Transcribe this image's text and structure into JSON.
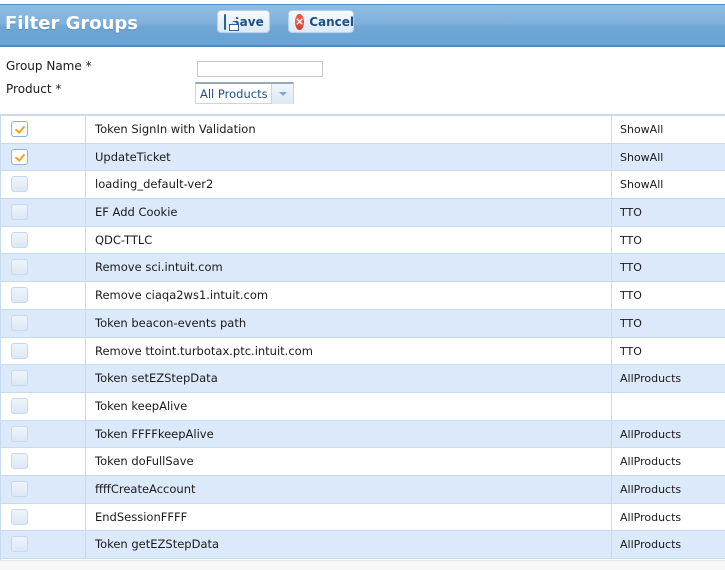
{
  "header": {
    "title": "Filter Groups",
    "save_label": "Save",
    "cancel_label": "Cancel"
  },
  "form": {
    "group_name_label": "Group Name *",
    "group_name_value": "",
    "product_label": "Product *",
    "product_selected": "All Products"
  },
  "colors": {
    "header_blue": "#7fb1dc",
    "row_alt": "#dbe9fa",
    "check_mark": "#f0a320",
    "link_text": "#1f4f85"
  },
  "rows": [
    {
      "checked": true,
      "name": "Token SignIn with Validation",
      "product": "ShowAll"
    },
    {
      "checked": true,
      "name": "UpdateTicket",
      "product": "ShowAll"
    },
    {
      "checked": false,
      "name": "loading_default-ver2",
      "product": "ShowAll"
    },
    {
      "checked": false,
      "name": "EF Add Cookie",
      "product": "TTO"
    },
    {
      "checked": false,
      "name": "QDC-TTLC",
      "product": "TTO"
    },
    {
      "checked": false,
      "name": "Remove sci.intuit.com",
      "product": "TTO"
    },
    {
      "checked": false,
      "name": "Remove ciaqa2ws1.intuit.com",
      "product": "TTO"
    },
    {
      "checked": false,
      "name": "Token beacon-events path",
      "product": "TTO"
    },
    {
      "checked": false,
      "name": "Remove ttoint.turbotax.ptc.intuit.com",
      "product": "TTO"
    },
    {
      "checked": false,
      "name": "Token setEZStepData",
      "product": "AllProducts"
    },
    {
      "checked": false,
      "name": "Token keepAlive",
      "product": ""
    },
    {
      "checked": false,
      "name": "Token FFFFkeepAlive",
      "product": "AllProducts"
    },
    {
      "checked": false,
      "name": "Token doFullSave",
      "product": "AllProducts"
    },
    {
      "checked": false,
      "name": "ffffCreateAccount",
      "product": "AllProducts"
    },
    {
      "checked": false,
      "name": "EndSessionFFFF",
      "product": "AllProducts"
    },
    {
      "checked": false,
      "name": "Token getEZStepData",
      "product": "AllProducts"
    }
  ]
}
